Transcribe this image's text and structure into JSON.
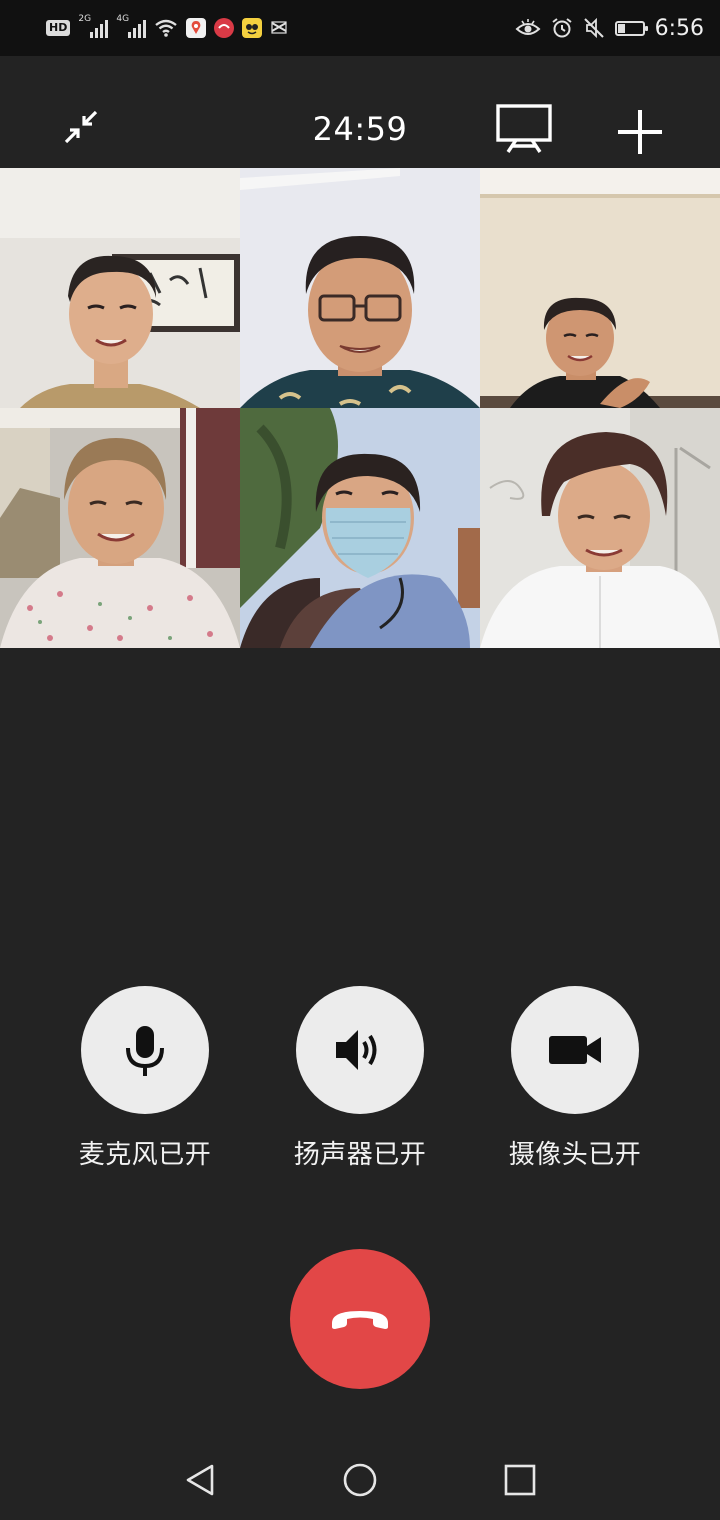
{
  "status_bar": {
    "hd_badge": "HD",
    "network_1": "2G",
    "network_2": "4G",
    "time": "6:56",
    "battery_level_percent": 30,
    "icons": [
      "hd-icon",
      "signal-2g-icon",
      "signal-4g-icon",
      "wifi-icon",
      "map-app-icon",
      "app-red-icon",
      "app-yellow-icon",
      "app-capcut-icon",
      "eye-icon",
      "alarm-icon",
      "mute-icon",
      "battery-icon"
    ]
  },
  "call_header": {
    "timer": "24:59",
    "icons": [
      "minimize-icon",
      "screen-share-icon",
      "add-icon"
    ]
  },
  "participants": [
    {
      "icon": "participant-video-1"
    },
    {
      "icon": "participant-video-2"
    },
    {
      "icon": "participant-video-3"
    },
    {
      "icon": "participant-video-4"
    },
    {
      "icon": "participant-video-5"
    },
    {
      "icon": "participant-video-6"
    }
  ],
  "controls": {
    "microphone_label": "麦克风已开",
    "speaker_label": "扬声器已开",
    "camera_label": "摄像头已开"
  },
  "colors": {
    "background": "#232323",
    "status_bar": "#111111",
    "control_circle": "#ececec",
    "hangup": "#e24747"
  },
  "nav_bar": {
    "icons": [
      "back-icon",
      "home-icon",
      "recents-icon"
    ]
  }
}
